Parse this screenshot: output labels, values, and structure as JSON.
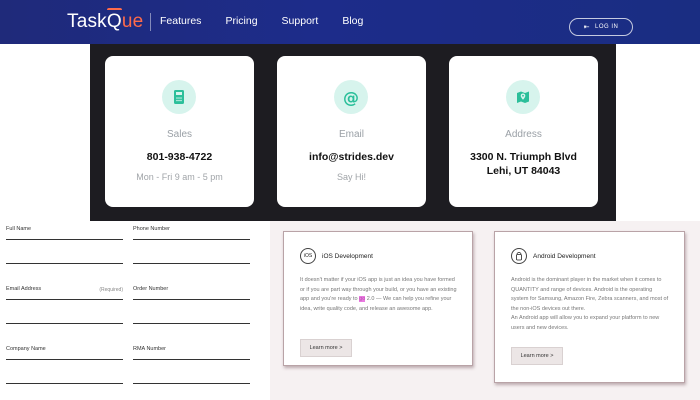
{
  "header": {
    "logo_text_1": "Task",
    "logo_text_2": "Q",
    "logo_text_3": "ue",
    "nav": [
      "Features",
      "Pricing",
      "Support",
      "Blog"
    ],
    "login_label": "LOG IN"
  },
  "contact": {
    "cards": [
      {
        "label": "Sales",
        "value": "801-938-4722",
        "value2": "",
        "sub": "Mon - Fri 9 am - 5 pm",
        "icon": "phone-icon"
      },
      {
        "label": "Email",
        "value": "info@strides.dev",
        "value2": "",
        "sub": "Say Hi!",
        "icon": "at-icon"
      },
      {
        "label": "Address",
        "value": "3300 N. Triumph Blvd",
        "value2": "Lehi, UT 84043",
        "sub": "",
        "icon": "map-icon"
      }
    ],
    "accent_color": "#2bbf9a"
  },
  "form": {
    "full_name": "Full Name",
    "phone": "Phone Number",
    "email": "Email Address",
    "email_hint": "(Required)",
    "order": "Order Number",
    "company": "Company Name",
    "rma": "RMA Number"
  },
  "services": [
    {
      "icon": "iOS",
      "title": "iOS Development",
      "body_1": "It doesn't matter if your iOS app is just an idea you have formed or if you are part way through your build, or you have an existing app and you're ready to ",
      "body_hl": "go",
      "body_2": " 2.0 — We can help you refine your idea, write quality code, and release an awesome app.",
      "button": "Learn more >"
    },
    {
      "icon": "android",
      "title": "Android Development",
      "body_1": "Android is the dominant player in the market when it comes to QUANTITY and range of devices. Android is the operating system for Samsung, Amazon Fire, Zebra scanners, and most of the non-iOS devices out there.",
      "body_2": "An Android app will allow you to expand your platform to new users and new devices.",
      "button": "Learn more >"
    }
  ]
}
